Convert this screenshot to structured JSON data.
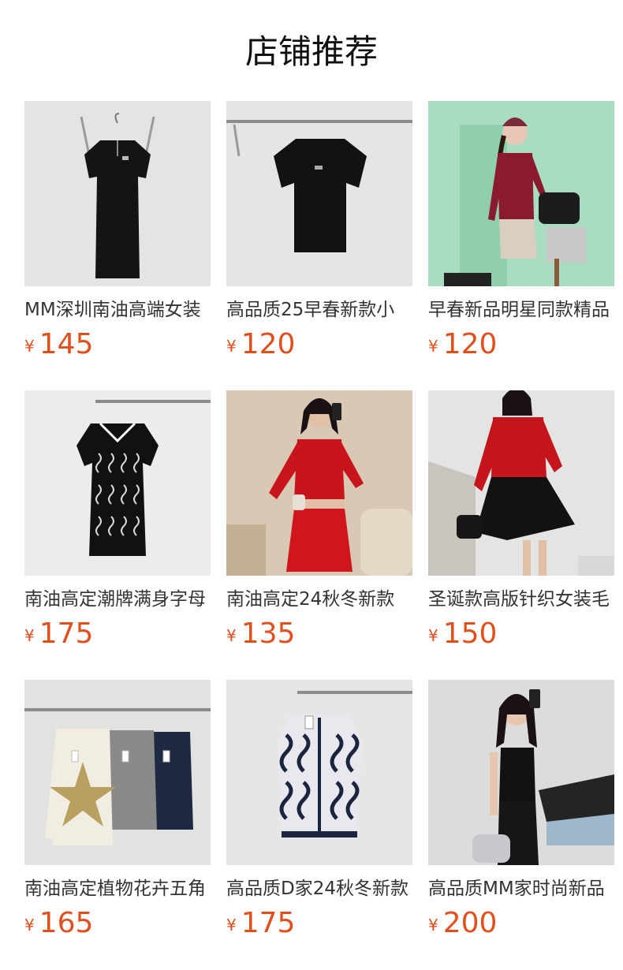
{
  "page_title": "店铺推荐",
  "products": [
    {
      "name": "MM深圳南油高端女装",
      "currency": "¥",
      "price": "145",
      "image": "black-zip-knit-dress-on-hanger"
    },
    {
      "name": "高品质25早春新款小",
      "currency": "¥",
      "price": "120",
      "image": "black-short-sleeve-knit-top-on-hanger"
    },
    {
      "name": "早春新品明星同款精品",
      "currency": "¥",
      "price": "120",
      "image": "model-burgundy-top-with-black-bag"
    },
    {
      "name": "南油高定潮牌满身字母",
      "currency": "¥",
      "price": "175",
      "image": "black-monogram-polo-knit-dress"
    },
    {
      "name": "南油高定24秋冬新款",
      "currency": "¥",
      "price": "135",
      "image": "model-red-knit-cardigan-and-skirt-set"
    },
    {
      "name": "圣诞款高版针织女装毛",
      "currency": "¥",
      "price": "150",
      "image": "model-red-cable-sweater-black-tulle-skirt"
    },
    {
      "name": "南油高定植物花卉五角",
      "currency": "¥",
      "price": "165",
      "image": "three-embellished-sweaters-on-rack"
    },
    {
      "name": "高品质D家24秋冬新款",
      "currency": "¥",
      "price": "175",
      "image": "navy-white-monogram-knit-cardigan"
    },
    {
      "name": "高品质MM家时尚新品",
      "currency": "¥",
      "price": "200",
      "image": "model-black-tank-top-and-skirt"
    }
  ]
}
